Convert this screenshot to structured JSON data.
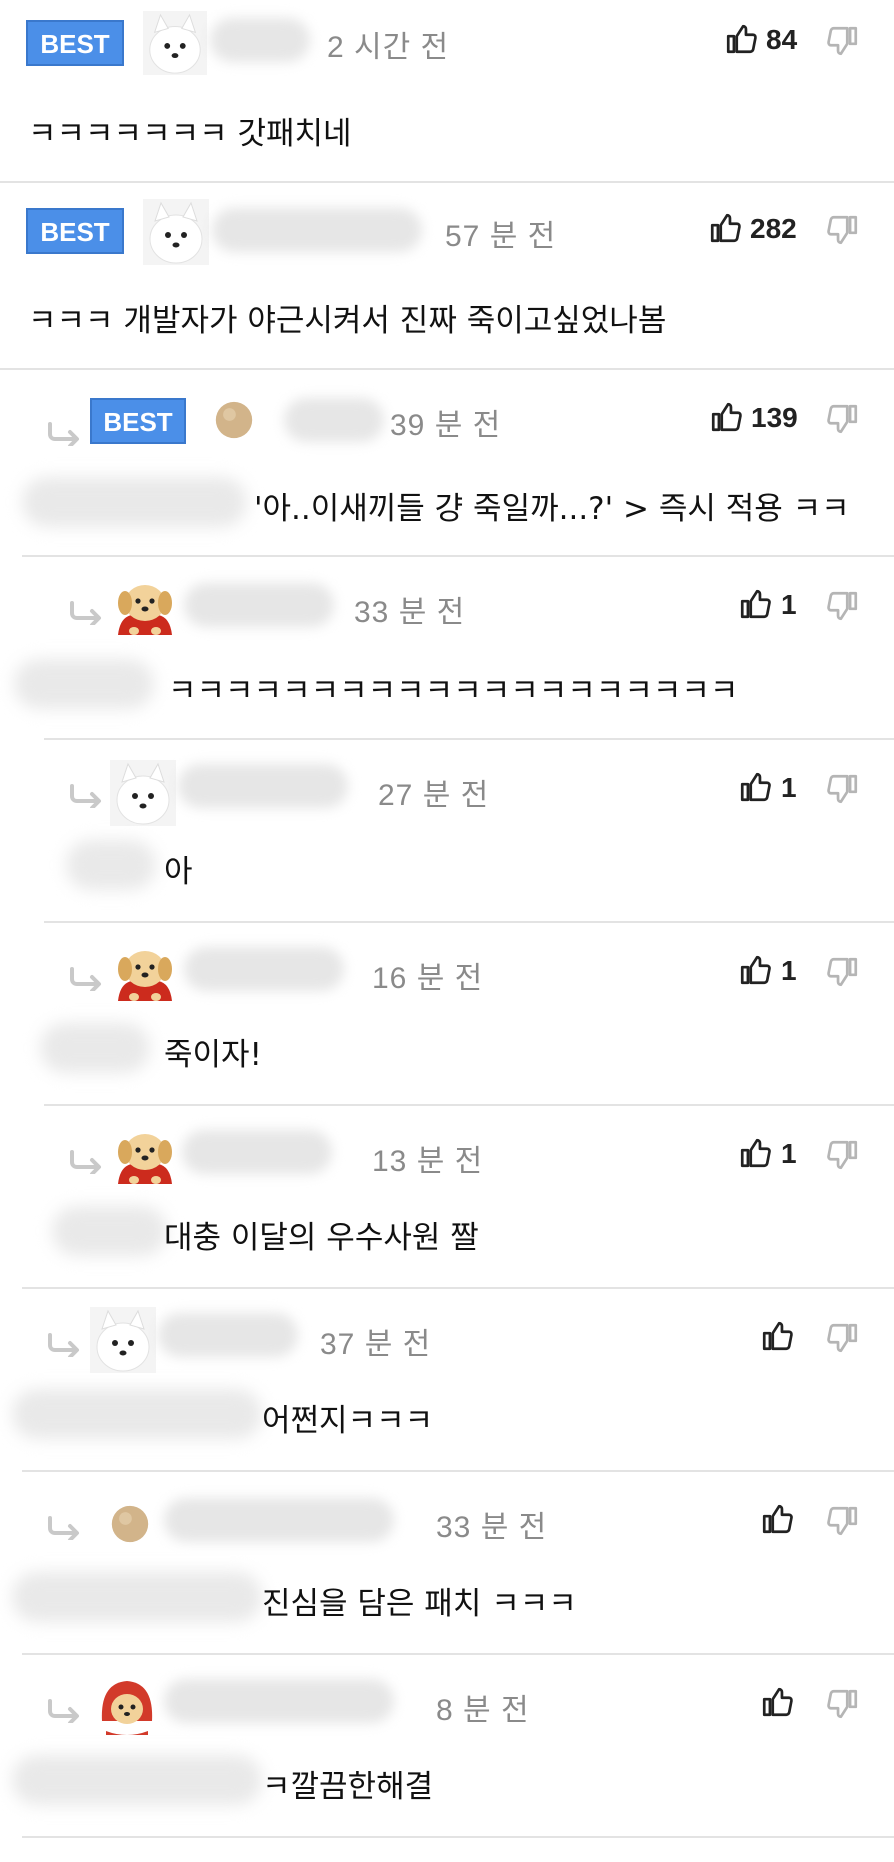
{
  "labels": {
    "best": "BEST"
  },
  "icons": {
    "like": "thumbs-up-icon",
    "dislike": "thumbs-down-icon",
    "reply": "reply-arrow-icon"
  },
  "colors": {
    "best_badge": "#4b8fe8",
    "time_text": "#8a8a8a",
    "divider": "#e3e3e3"
  },
  "comments": [
    {
      "time": "2 시간 전",
      "likes": "84",
      "text": "ㅋㅋㅋㅋㅋㅋㅋ 갓패치네",
      "best": true,
      "avatar": "samoyed-avatar"
    },
    {
      "time": "57 분 전",
      "likes": "282",
      "text": "ㅋㅋㅋ 개발자가 야근시켜서 진짜 죽이고싶었나봄",
      "best": true,
      "avatar": "samoyed-avatar"
    },
    {
      "time": "39 분 전",
      "likes": "139",
      "text": "'아..이새끼들 걍 죽일까...?' > 즉시 적용 ㅋㅋ",
      "best": true,
      "avatar": "tan-circle-avatar"
    },
    {
      "time": "33 분 전",
      "likes": "1",
      "text": "ㅋㅋㅋㅋㅋㅋㅋㅋㅋㅋㅋㅋㅋㅋㅋㅋㅋㅋㅋㅋ",
      "avatar": "puppy-cape-avatar"
    },
    {
      "time": "27 분 전",
      "likes": "1",
      "text": "아",
      "avatar": "samoyed-avatar"
    },
    {
      "time": "16 분 전",
      "likes": "1",
      "text": "죽이자!",
      "avatar": "puppy-cape-avatar"
    },
    {
      "time": "13 분 전",
      "likes": "1",
      "text": "대충 이달의 우수사원 짤",
      "avatar": "puppy-cape-avatar"
    },
    {
      "time": "37 분 전",
      "likes": "",
      "text": "어쩐지ㅋㅋㅋ",
      "avatar": "samoyed-avatar"
    },
    {
      "time": "33 분 전",
      "likes": "",
      "text": "진심을 담은 패치 ㅋㅋㅋ",
      "avatar": "tan-circle-avatar"
    },
    {
      "time": "8 분 전",
      "likes": "",
      "text": "ㅋ깔끔한해결",
      "avatar": "puppy-hood-avatar"
    }
  ]
}
